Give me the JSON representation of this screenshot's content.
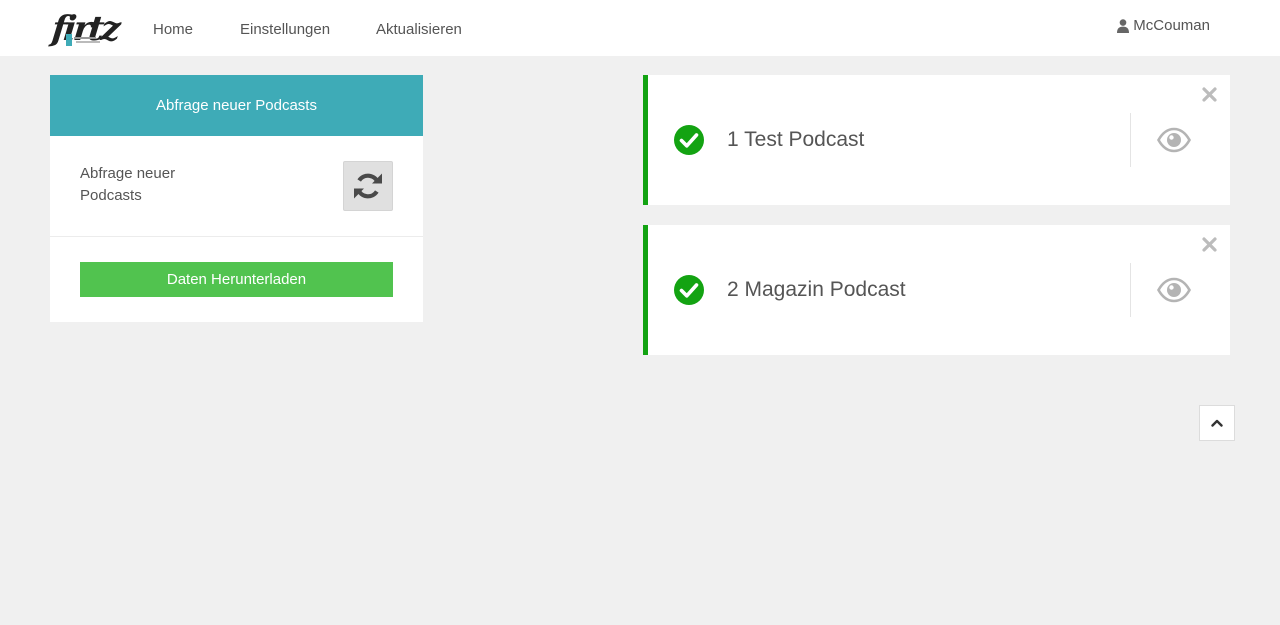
{
  "nav": {
    "logo_text": "firtz",
    "links": [
      "Home",
      "Einstellungen",
      "Aktualisieren"
    ],
    "user": "McCouman"
  },
  "panel": {
    "title": "Abfrage neuer Podcasts",
    "row_label": "Abfrage neuer Podcasts",
    "download_label": "Daten Herunterladen"
  },
  "podcasts": [
    {
      "title": "1 Test Podcast",
      "status": "ok"
    },
    {
      "title": "2 Magazin Podcast",
      "status": "ok"
    }
  ],
  "icons": {
    "user": "user-icon",
    "refresh": "refresh-icon",
    "check": "check-circle-icon",
    "view": "eye-icon",
    "close": "close-icon",
    "scroll_top": "chevron-up-icon"
  },
  "colors": {
    "panel_header": "#3eabb7",
    "download_button": "#51c34f",
    "card_accent": "#13a312",
    "check": "#13a312"
  }
}
